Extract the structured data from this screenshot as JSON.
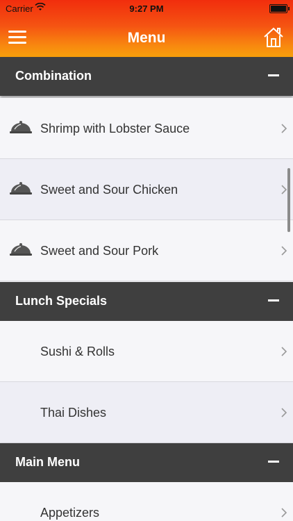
{
  "status_bar": {
    "carrier": "Carrier",
    "time": "9:27 PM"
  },
  "header": {
    "title": "Menu",
    "menu_icon": "hamburger-icon",
    "home_icon": "home-icon"
  },
  "sections": [
    {
      "title": "Combination",
      "items": [
        {
          "label": "Shrimp with Lobster Sauce",
          "icon": "dish-cover-icon"
        },
        {
          "label": "Sweet and Sour Chicken",
          "icon": "dish-cover-icon"
        },
        {
          "label": "Sweet and Sour Pork",
          "icon": "dish-cover-icon"
        }
      ]
    },
    {
      "title": "Lunch Specials",
      "items": [
        {
          "label": "Sushi & Rolls"
        },
        {
          "label": "Thai Dishes"
        }
      ]
    },
    {
      "title": "Main Menu",
      "items": [
        {
          "label": "Appetizers"
        }
      ]
    }
  ],
  "colors": {
    "header_top": "#f12d0d",
    "header_bottom": "#f7a00c",
    "section_bg": "#3f3f3f"
  }
}
